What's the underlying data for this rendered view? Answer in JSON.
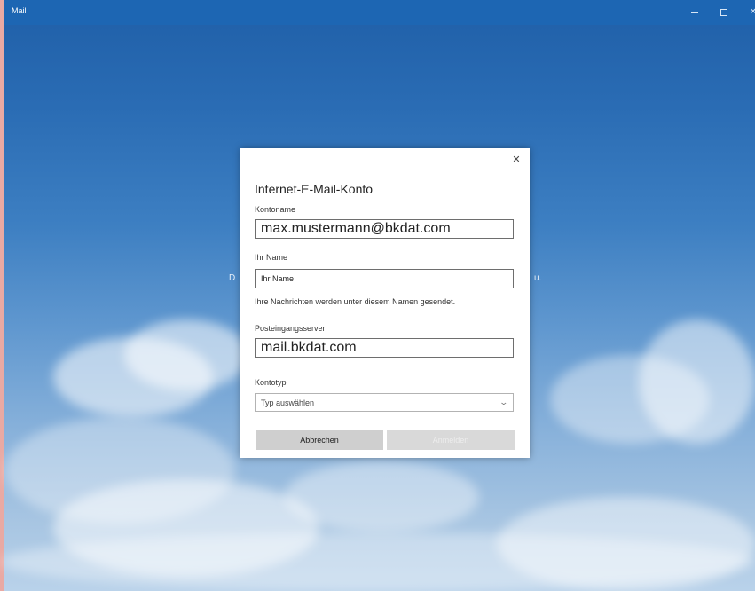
{
  "window": {
    "title": "Mail",
    "controls": {
      "minimize": "–",
      "maximize": "□",
      "close": "✕"
    }
  },
  "background": {
    "text_left": "D",
    "text_right": "u."
  },
  "dialog": {
    "heading": "Internet-E-Mail-Konto",
    "close_icon": "✕",
    "account_name": {
      "label": "Kontoname",
      "value": "max.mustermann@bkdat.com"
    },
    "your_name": {
      "label": "Ihr Name",
      "value": "Ihr Name",
      "hint": "Ihre Nachrichten werden unter diesem Namen gesendet."
    },
    "incoming_server": {
      "label": "Posteingangsserver",
      "value": "mail.bkdat.com"
    },
    "account_type": {
      "label": "Kontotyp",
      "selected": "Typ auswählen"
    },
    "buttons": {
      "cancel": "Abbrechen",
      "sign_in": "Anmelden"
    }
  }
}
